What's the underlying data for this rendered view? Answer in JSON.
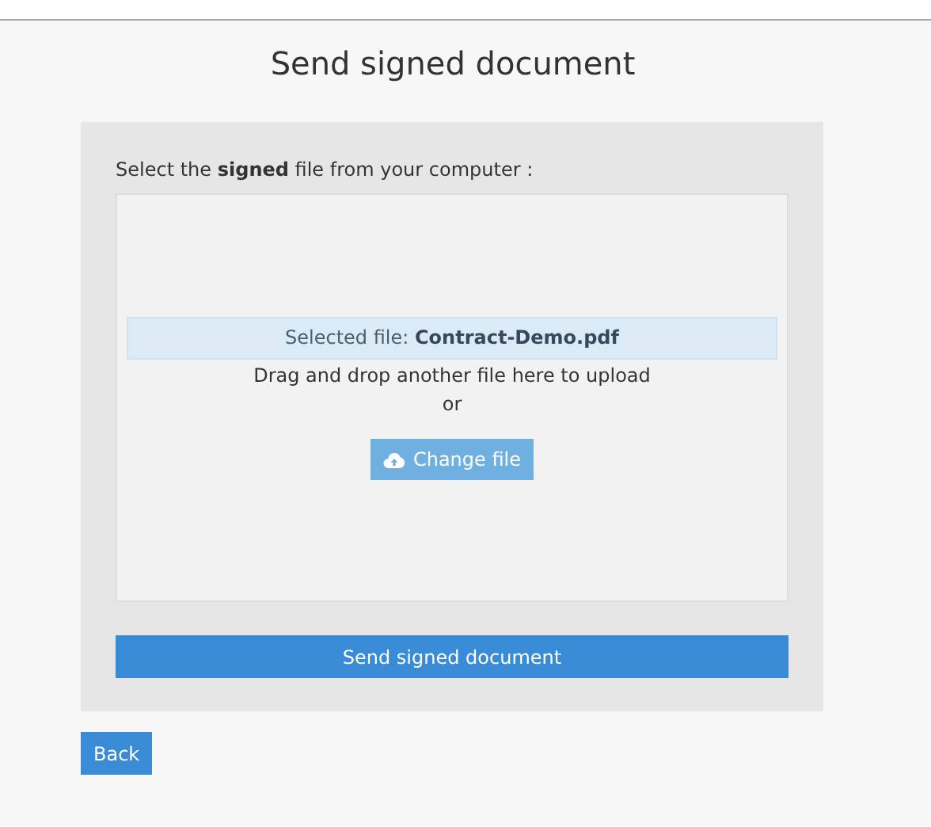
{
  "title": "Send signed document",
  "upload": {
    "label": "Select the **signed** file from your computer :",
    "selected_prefix": "Selected file:",
    "selected_file": "Contract-Demo.pdf",
    "hint": "Drag and drop another file here to upload",
    "separator": "or",
    "change_button": "Change file"
  },
  "submit_button": "Send signed document",
  "back_button": "Back"
}
